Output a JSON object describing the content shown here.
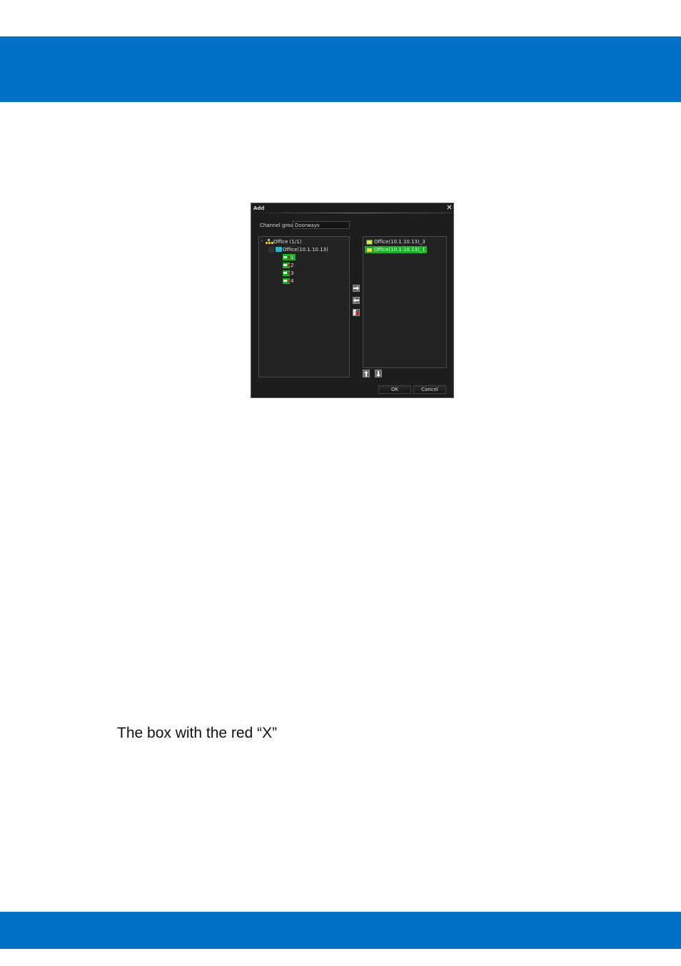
{
  "dialog": {
    "title": "Add",
    "close_label": "✕",
    "channel_group_label": "Channel group",
    "channel_group_value": "Doorways",
    "tree": {
      "root_label": "Office (1/1)",
      "device_label": "Office(10.1.10.13)",
      "channels": [
        "1",
        "2",
        "3",
        "4"
      ],
      "selected_channel": "1"
    },
    "selected_list": [
      {
        "label": "Office(10.1.10.13)_3",
        "active": false
      },
      {
        "label": "Office(10.1.10.13)_1",
        "active": true
      }
    ],
    "ok_label": "OK",
    "cancel_label": "Cancel"
  },
  "caption": "The box with the red “X”",
  "colors": {
    "brand_band": "#0071c5",
    "dialog_bg": "#1d1d1d",
    "highlight": "#1db02a"
  }
}
